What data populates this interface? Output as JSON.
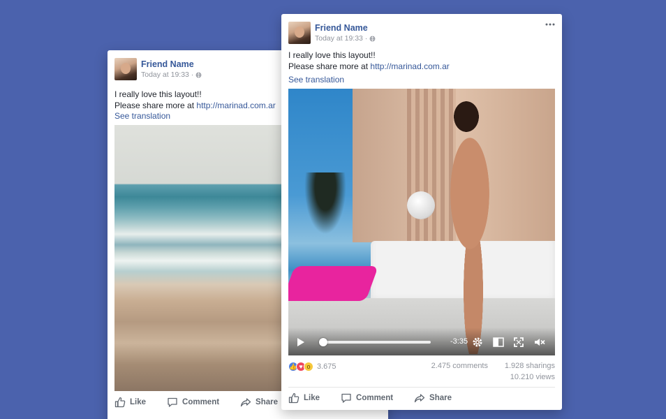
{
  "back_post": {
    "friend_name": "Friend Name",
    "timestamp": "Today at 19:33 ·",
    "text_line1": "I really love this layout!!",
    "text_line2_prefix": "Please share more at ",
    "link": "http://marinad.com.ar",
    "see_translation": "See translation",
    "actions": {
      "like": "Like",
      "comment": "Comment",
      "share": "Share"
    }
  },
  "front_post": {
    "friend_name": "Friend Name",
    "timestamp": "Today at 19:33 ·",
    "text_line1": "I really love this layout!!",
    "text_line2_prefix": "Please share more at ",
    "link": "http://marinad.com.ar",
    "see_translation": "See translation",
    "video": {
      "time_remaining": "-3:35",
      "progress": 0.0,
      "icons": [
        "play-icon",
        "settings-icon",
        "pip-icon",
        "fullscreen-icon",
        "mute-icon"
      ]
    },
    "stats": {
      "reactions_count": "3.675",
      "comments": "2.475 comments",
      "sharings": "1.928 sharings",
      "views": "10.210 views"
    },
    "actions": {
      "like": "Like",
      "comment": "Comment",
      "share": "Share"
    }
  },
  "colors": {
    "background": "#4b62ad",
    "link": "#365899",
    "action_text": "#606770"
  }
}
